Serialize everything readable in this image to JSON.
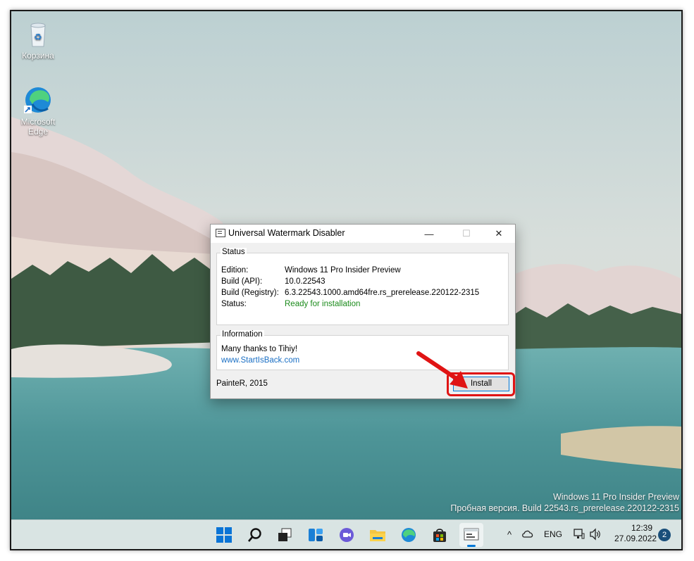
{
  "desktop": {
    "icons": [
      {
        "label": "Корзина"
      },
      {
        "label": "Microsoft Edge"
      }
    ],
    "watermark": {
      "line1": "Windows 11 Pro Insider Preview",
      "line2": "Пробная версия. Build 22543.rs_prerelease.220122-2315"
    }
  },
  "dialog": {
    "title": "Universal Watermark Disabler",
    "window_buttons": {
      "minimize": "—",
      "maximize": "☐",
      "close": "✕"
    },
    "status": {
      "legend": "Status",
      "rows": [
        {
          "key": "Edition:",
          "value": "Windows 11 Pro Insider Preview"
        },
        {
          "key": "Build (API):",
          "value": "10.0.22543"
        },
        {
          "key": "Build (Registry):",
          "value": "6.3.22543.1000.amd64fre.rs_prerelease.220122-2315"
        },
        {
          "key": "Status:",
          "value": "Ready for installation"
        }
      ],
      "status_color": "#1a8a1a"
    },
    "information": {
      "legend": "Information",
      "thanks": "Many thanks to Tihiy!",
      "link": "www.StartIsBack.com"
    },
    "footer": "PainteR, 2015",
    "install_label": "Install",
    "highlight_color": "#e01414"
  },
  "taskbar": {
    "icons": [
      "windows-start-icon",
      "search-icon",
      "task-view-icon",
      "widgets-icon",
      "chat-icon",
      "file-explorer-icon",
      "edge-icon",
      "store-icon",
      "watermark-disabler-icon"
    ],
    "tray": {
      "chevron": "^",
      "language": "ENG",
      "time": "12:39",
      "date": "27.09.2022",
      "notifications": "2"
    }
  }
}
